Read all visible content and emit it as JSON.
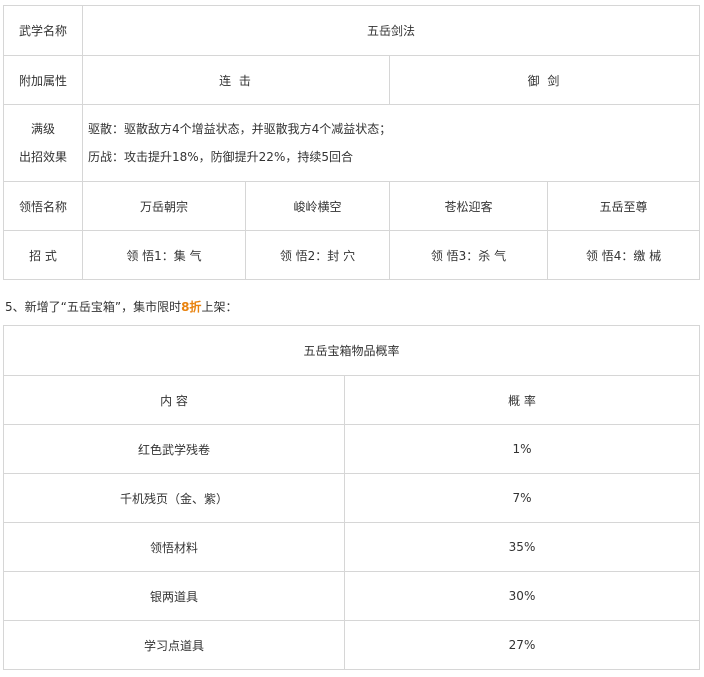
{
  "skill_table": {
    "name_label": "武学名称",
    "name_value": "五岳剑法",
    "attr_label": "附加属性",
    "attr_values": [
      "连 击",
      "御 剑"
    ],
    "max_label_line1": "满级",
    "max_label_line2": "出招效果",
    "effect_line1": "驱散：驱散敌方4个增益状态，并驱散我方4个减益状态；",
    "effect_line2": "历战：攻击提升18%，防御提升22%，持续5回合",
    "insight_label": "领悟名称",
    "insight_names": [
      "万岳朝宗",
      "峻岭横空",
      "苍松迎客",
      "五岳至尊"
    ],
    "move_label": "招 式",
    "moves": [
      "领 悟1：集 气",
      "领 悟2：封 穴",
      "领 悟3：杀 气",
      "领 悟4：缴 械"
    ]
  },
  "note": {
    "prefix": "5、新增了“五岳宝箱”，集市限时",
    "highlight": "8折",
    "suffix": "上架："
  },
  "box_table": {
    "title": "五岳宝箱物品概率",
    "col_content": "内 容",
    "col_rate": "概 率",
    "rows": [
      {
        "item": "红色武学残卷",
        "rate": "1%"
      },
      {
        "item": "千机残页（金、紫）",
        "rate": "7%"
      },
      {
        "item": "领悟材料",
        "rate": "35%"
      },
      {
        "item": "银两道具",
        "rate": "30%"
      },
      {
        "item": "学习点道具",
        "rate": "27%"
      }
    ]
  },
  "colors": {
    "border": "#d6d6d6",
    "text": "#333333",
    "highlight": "#e8820e"
  }
}
